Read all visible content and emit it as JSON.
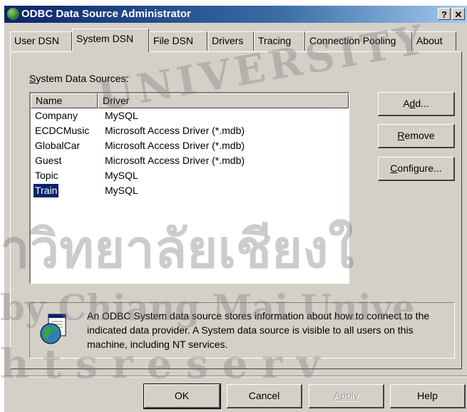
{
  "window": {
    "title": "ODBC Data Source Administrator",
    "help_button": "?",
    "close_button": "✕"
  },
  "tabs": [
    {
      "label": "User DSN"
    },
    {
      "label": "System DSN"
    },
    {
      "label": "File DSN"
    },
    {
      "label": "Drivers"
    },
    {
      "label": "Tracing"
    },
    {
      "label": "Connection Pooling"
    },
    {
      "label": "About"
    }
  ],
  "active_tab": "System DSN",
  "system_sources": {
    "label_first": "S",
    "label_rest": "ystem Data Sources:",
    "columns": [
      "Name",
      "Driver"
    ],
    "rows": [
      {
        "name": "Company",
        "driver": "MySQL"
      },
      {
        "name": "ECDCMusic",
        "driver": "Microsoft Access Driver (*.mdb)"
      },
      {
        "name": "GlobalCar",
        "driver": "Microsoft Access Driver (*.mdb)"
      },
      {
        "name": "Guest",
        "driver": "Microsoft Access Driver (*.mdb)"
      },
      {
        "name": "Topic",
        "driver": "MySQL"
      },
      {
        "name": "Train",
        "driver": "MySQL"
      }
    ],
    "selected": "Train"
  },
  "side_buttons": {
    "add": {
      "pre": "A",
      "u": "d",
      "post": "d..."
    },
    "remove": {
      "pre": "",
      "u": "R",
      "post": "emove"
    },
    "configure": {
      "pre": "",
      "u": "C",
      "post": "onfigure..."
    }
  },
  "info": {
    "icon": "globe-database-icon",
    "text": "An ODBC System data source stores information about how to connect to the indicated data provider.   A System data source is visible to all users on this machine, including NT services."
  },
  "bottom_buttons": {
    "ok": "OK",
    "cancel": "Cancel",
    "apply": "Apply",
    "help": "Help"
  },
  "watermark": {
    "line1": "UNIVERSITY",
    "line2": "าวิทยาลัยเชียงใ",
    "line3": "by Chiang Mai Unive",
    "line4": "h t s   r e s e r v"
  },
  "colors": {
    "face": "#d4d0c8",
    "title_start": "#0a246a",
    "title_end": "#a6caf0",
    "selection": "#0a246a"
  }
}
